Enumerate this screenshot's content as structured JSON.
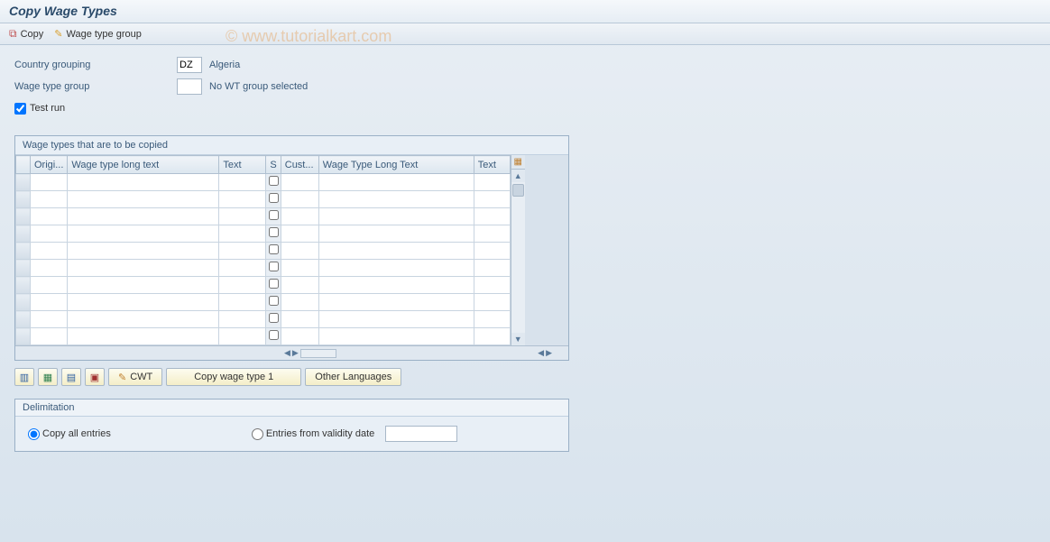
{
  "title": "Copy Wage Types",
  "toolbar": {
    "copy_label": "Copy",
    "wage_type_group_label": "Wage type group"
  },
  "watermark": "© www.tutorialkart.com",
  "form": {
    "country_grouping_label": "Country grouping",
    "country_grouping_value": "DZ",
    "country_grouping_text": "Algeria",
    "wage_type_group_label": "Wage type group",
    "wage_type_group_value": "",
    "wage_type_group_text": "No WT group selected",
    "test_run_label": "Test run",
    "test_run_checked": true
  },
  "table": {
    "title": "Wage types that are to be copied",
    "columns": {
      "origi": "Origi...",
      "wage_long": "Wage type long text",
      "text1": "Text",
      "s": "S",
      "cust": "Cust...",
      "wage_long2": "Wage Type Long Text",
      "text2": "Text"
    },
    "row_count": 10
  },
  "buttons": {
    "cwt_label": "CWT",
    "copy_wage_type_label": "Copy wage type 1",
    "other_languages_label": "Other Languages"
  },
  "delimitation": {
    "title": "Delimitation",
    "copy_all_label": "Copy all entries",
    "entries_from_label": "Entries from validity date",
    "selected": "copy_all"
  }
}
